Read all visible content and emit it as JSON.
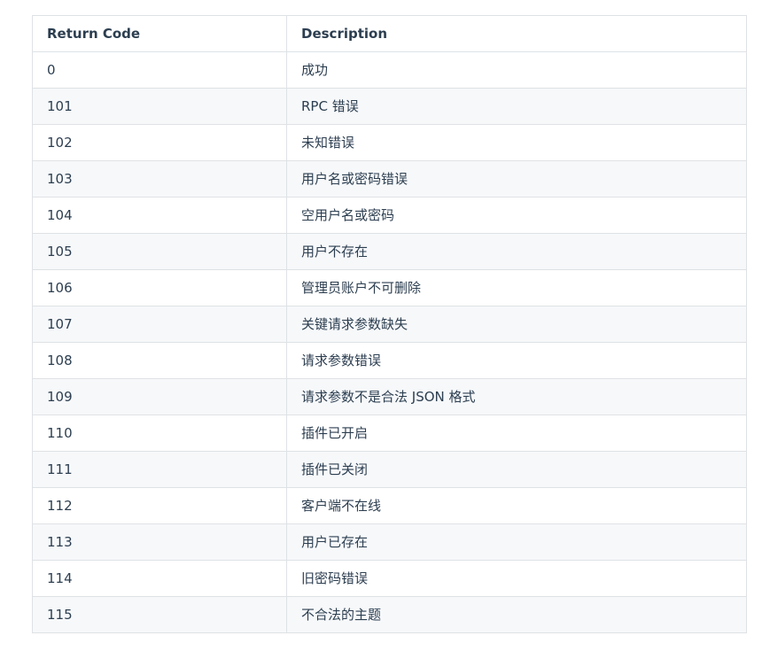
{
  "table": {
    "headers": [
      "Return Code",
      "Description"
    ],
    "rows": [
      {
        "code": "0",
        "description": "成功"
      },
      {
        "code": "101",
        "description": "RPC 错误"
      },
      {
        "code": "102",
        "description": "未知错误"
      },
      {
        "code": "103",
        "description": "用户名或密码错误"
      },
      {
        "code": "104",
        "description": "空用户名或密码"
      },
      {
        "code": "105",
        "description": "用户不存在"
      },
      {
        "code": "106",
        "description": "管理员账户不可删除"
      },
      {
        "code": "107",
        "description": "关键请求参数缺失"
      },
      {
        "code": "108",
        "description": "请求参数错误"
      },
      {
        "code": "109",
        "description": "请求参数不是合法 JSON 格式"
      },
      {
        "code": "110",
        "description": "插件已开启"
      },
      {
        "code": "111",
        "description": "插件已关闭"
      },
      {
        "code": "112",
        "description": "客户端不在线"
      },
      {
        "code": "113",
        "description": "用户已存在"
      },
      {
        "code": "114",
        "description": "旧密码错误"
      },
      {
        "code": "115",
        "description": "不合法的主题"
      }
    ]
  }
}
